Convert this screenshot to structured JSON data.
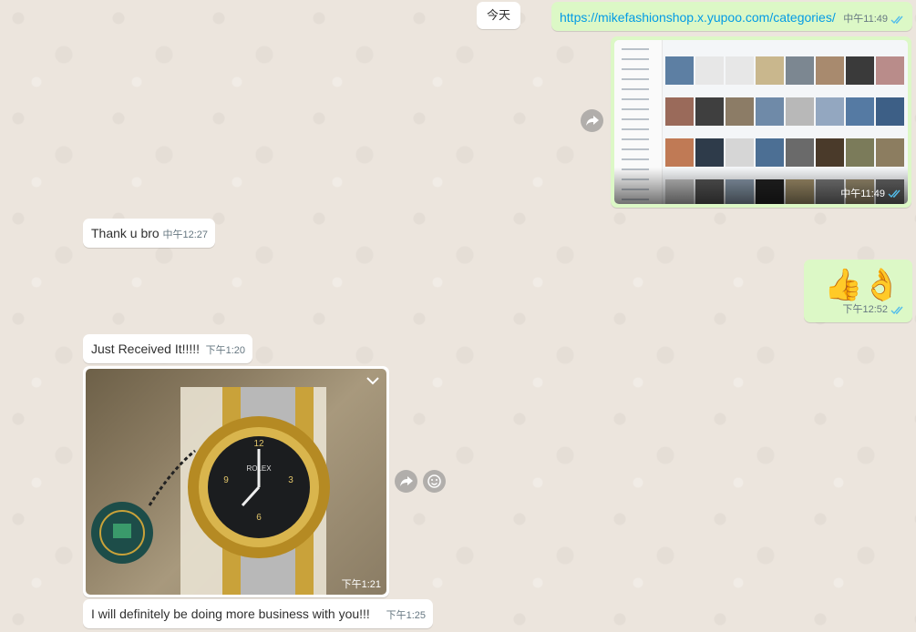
{
  "date_divider": "今天",
  "messages": [
    {
      "id": "m1",
      "direction": "out",
      "type": "link",
      "text": "https://mikefashionshop.x.yupoo.com/categories/",
      "time": "中午11:49"
    },
    {
      "id": "m2",
      "direction": "out",
      "type": "image",
      "time": "中午11:49"
    },
    {
      "id": "m3",
      "direction": "in",
      "type": "text",
      "text": "Thank u bro",
      "time": "中午12:27"
    },
    {
      "id": "m4",
      "direction": "out",
      "type": "emoji",
      "text": "👍👌",
      "time": "下午12:52"
    },
    {
      "id": "m5",
      "direction": "in",
      "type": "text",
      "text": "Just Received It!!!!!",
      "time": "下午1:20"
    },
    {
      "id": "m6",
      "direction": "in",
      "type": "image",
      "time": "下午1:21"
    },
    {
      "id": "m7",
      "direction": "in",
      "type": "text",
      "text": "I will definitely be doing more business with you!!!",
      "time": "下午1:25"
    }
  ],
  "icons": {
    "forward": "forward-icon",
    "react": "emoji-react-icon",
    "menu": "chevron-down-icon",
    "read": "double-check-icon"
  },
  "colors": {
    "outgoing_bubble": "#dcf8c6",
    "incoming_bubble": "#ffffff",
    "read_ticks": "#53bdeb",
    "link": "#039be5"
  }
}
